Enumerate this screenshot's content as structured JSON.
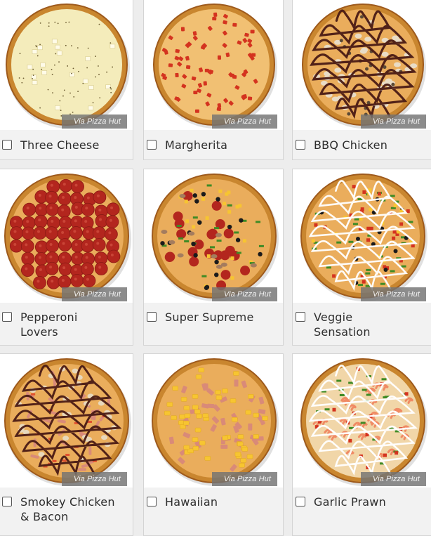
{
  "pizzas": [
    {
      "label": "Three Cheese",
      "credit": "Via Pizza Hut",
      "checked": false,
      "topping": "cheese"
    },
    {
      "label": "Margherita",
      "credit": "Via Pizza Hut",
      "checked": false,
      "topping": "tomato"
    },
    {
      "label": "BBQ Chicken",
      "credit": "Via Pizza Hut",
      "checked": false,
      "topping": "bbq"
    },
    {
      "label": "Pepperoni Lovers",
      "credit": "Via Pizza Hut",
      "checked": false,
      "topping": "pepperoni"
    },
    {
      "label": "Super Supreme",
      "credit": "Via Pizza Hut",
      "checked": false,
      "topping": "supreme"
    },
    {
      "label": "Veggie Sensation",
      "credit": "Via Pizza Hut",
      "checked": false,
      "topping": "veggie"
    },
    {
      "label": "Smokey Chicken & Bacon",
      "credit": "Via Pizza Hut",
      "checked": false,
      "topping": "smokey"
    },
    {
      "label": "Hawaiian",
      "credit": "Via Pizza Hut",
      "checked": false,
      "topping": "hawaiian"
    },
    {
      "label": "Garlic Prawn",
      "credit": "Via Pizza Hut",
      "checked": false,
      "topping": "prawn"
    }
  ],
  "colors": {
    "crust": "#c9862f",
    "crust_dark": "#9e5a1c",
    "cheese": "#f1e6a4",
    "sauce": "#e8a246",
    "pepperoni": "#b3261e",
    "tomato": "#d4331f",
    "bbq": "#4a1a14",
    "bacon": "#d98a78",
    "pineapple": "#f7c531",
    "olive": "#1b1b1b",
    "pepper": "#3f8b25",
    "prawn": "#f08a64",
    "mayo": "#ffffff"
  }
}
